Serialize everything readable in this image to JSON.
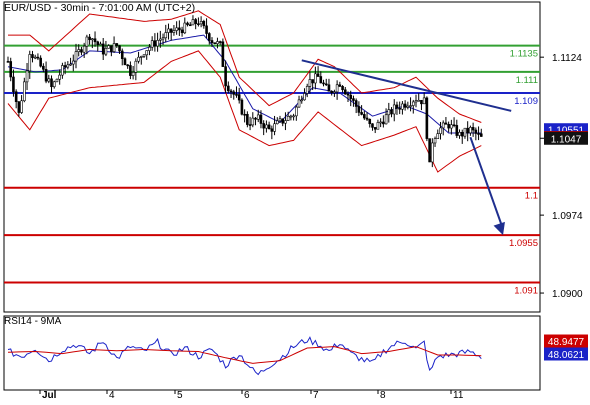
{
  "header": {
    "title": "EUR/USD - 30min - 7:01:00 AM (UTC+2)"
  },
  "rsi_label": "RSI14 - 9MA",
  "colors": {
    "candle": "#000000",
    "bollinger": "#cc0000",
    "moving_average": "#1a1aa8",
    "support": "#cc0000",
    "resistance": "#33a033",
    "pivot": "#1a22c8",
    "trendline": "#1f2f8f",
    "arrow": "#1f2f8f",
    "axis": "#000000",
    "grid": "#cccccc",
    "rsi_line": "#1a22c8",
    "rsi_ma": "#cc0000",
    "price_badge_current": "#111111",
    "price_badge_blue": "#1a22c8",
    "price_badge_red": "#cc0000"
  },
  "chart_data": [
    {
      "type": "candlestick",
      "title": "EUR/USD - 30min - 7:01:00 AM (UTC+2)",
      "y_ticks": [
        "1.1124",
        "1.1047",
        "1.0974",
        "1.0900"
      ],
      "ylim": [
        1.0882,
        1.1165
      ],
      "x_ticks": [
        "Jul",
        "4",
        "5",
        "6",
        "7",
        "8",
        "11"
      ],
      "candle_count": 175,
      "price_points": [
        [
          0,
          1.112
        ],
        [
          4,
          1.107
        ],
        [
          8,
          1.113
        ],
        [
          12,
          1.1115
        ],
        [
          16,
          1.1095
        ],
        [
          20,
          1.1112
        ],
        [
          25,
          1.1125
        ],
        [
          30,
          1.1145
        ],
        [
          35,
          1.113
        ],
        [
          40,
          1.1135
        ],
        [
          45,
          1.111
        ],
        [
          50,
          1.113
        ],
        [
          55,
          1.114
        ],
        [
          60,
          1.1148
        ],
        [
          65,
          1.1152
        ],
        [
          70,
          1.1158
        ],
        [
          75,
          1.114
        ],
        [
          78,
          1.1135
        ],
        [
          80,
          1.11
        ],
        [
          84,
          1.1085
        ],
        [
          88,
          1.1062
        ],
        [
          92,
          1.1065
        ],
        [
          96,
          1.1055
        ],
        [
          100,
          1.1062
        ],
        [
          105,
          1.107
        ],
        [
          110,
          1.11
        ],
        [
          114,
          1.1105
        ],
        [
          118,
          1.109
        ],
        [
          122,
          1.11
        ],
        [
          126,
          1.1085
        ],
        [
          130,
          1.107
        ],
        [
          134,
          1.1055
        ],
        [
          138,
          1.1065
        ],
        [
          142,
          1.1075
        ],
        [
          146,
          1.108
        ],
        [
          150,
          1.1085
        ],
        [
          153,
          1.1082
        ],
        [
          155,
          1.102
        ],
        [
          156,
          1.1045
        ],
        [
          158,
          1.1055
        ],
        [
          162,
          1.106
        ],
        [
          166,
          1.105
        ],
        [
          170,
          1.1055
        ],
        [
          174,
          1.1047
        ]
      ],
      "bands": [
        {
          "name": "upper",
          "values": [
            [
              0,
              1.1145
            ],
            [
              8,
              1.1145
            ],
            [
              15,
              1.113
            ],
            [
              30,
              1.1165
            ],
            [
              50,
              1.1158
            ],
            [
              60,
              1.116
            ],
            [
              70,
              1.1168
            ],
            [
              78,
              1.1155
            ],
            [
              85,
              1.1105
            ],
            [
              96,
              1.1078
            ],
            [
              105,
              1.109
            ],
            [
              114,
              1.1122
            ],
            [
              120,
              1.1115
            ],
            [
              130,
              1.109
            ],
            [
              142,
              1.1095
            ],
            [
              150,
              1.1105
            ],
            [
              158,
              1.1085
            ],
            [
              166,
              1.107
            ],
            [
              174,
              1.1062
            ]
          ]
        },
        {
          "name": "lower",
          "values": [
            [
              0,
              1.108
            ],
            [
              8,
              1.1055
            ],
            [
              15,
              1.1085
            ],
            [
              30,
              1.1095
            ],
            [
              50,
              1.11
            ],
            [
              60,
              1.112
            ],
            [
              70,
              1.113
            ],
            [
              78,
              1.1105
            ],
            [
              85,
              1.1055
            ],
            [
              96,
              1.104
            ],
            [
              105,
              1.1045
            ],
            [
              114,
              1.1072
            ],
            [
              120,
              1.106
            ],
            [
              130,
              1.104
            ],
            [
              142,
              1.105
            ],
            [
              150,
              1.1058
            ],
            [
              158,
              1.1015
            ],
            [
              166,
              1.103
            ],
            [
              174,
              1.104
            ]
          ]
        },
        {
          "name": "moving_average",
          "values": [
            [
              0,
              1.1115
            ],
            [
              10,
              1.111
            ],
            [
              20,
              1.1112
            ],
            [
              30,
              1.113
            ],
            [
              45,
              1.1128
            ],
            [
              60,
              1.114
            ],
            [
              72,
              1.1145
            ],
            [
              80,
              1.112
            ],
            [
              90,
              1.1075
            ],
            [
              100,
              1.1062
            ],
            [
              112,
              1.1095
            ],
            [
              122,
              1.109
            ],
            [
              134,
              1.1068
            ],
            [
              146,
              1.1078
            ],
            [
              154,
              1.107
            ],
            [
              162,
              1.1052
            ],
            [
              174,
              1.1052
            ]
          ]
        }
      ],
      "horizontal_levels": [
        {
          "value": 1.1135,
          "label": "1.1135",
          "kind": "resistance"
        },
        {
          "value": 1.111,
          "label": "1.111",
          "kind": "resistance"
        },
        {
          "value": 1.109,
          "label": "1.109",
          "kind": "pivot"
        },
        {
          "value": 1.1,
          "label": "1.1",
          "kind": "support"
        },
        {
          "value": 1.0955,
          "label": "1.0955",
          "kind": "support"
        },
        {
          "value": 1.091,
          "label": "1.091",
          "kind": "support"
        }
      ],
      "trendline": {
        "from": [
          108,
          1.1121
        ],
        "to": [
          185,
          1.1073
        ]
      },
      "forecast_arrow": {
        "from": [
          170,
          1.1048
        ],
        "to": [
          182,
          1.0955
        ]
      },
      "price_badges": [
        {
          "label": "1.10551",
          "value": 1.10551,
          "kind": "blue"
        },
        {
          "label": "1.10477",
          "value": 1.10477,
          "kind": "red"
        },
        {
          "label": "1.1047",
          "value": 1.1047,
          "kind": "current"
        }
      ]
    },
    {
      "type": "line",
      "title": "RSI14 - 9MA",
      "series": [
        {
          "name": "RSI14",
          "values": [
            [
              0,
              55
            ],
            [
              5,
              48
            ],
            [
              10,
              60
            ],
            [
              15,
              42
            ],
            [
              20,
              58
            ],
            [
              25,
              65
            ],
            [
              30,
              52
            ],
            [
              35,
              70
            ],
            [
              40,
              45
            ],
            [
              45,
              62
            ],
            [
              50,
              55
            ],
            [
              55,
              68
            ],
            [
              60,
              50
            ],
            [
              65,
              60
            ],
            [
              70,
              48
            ],
            [
              75,
              58
            ],
            [
              80,
              35
            ],
            [
              85,
              52
            ],
            [
              90,
              28
            ],
            [
              92,
              22
            ],
            [
              96,
              35
            ],
            [
              100,
              45
            ],
            [
              105,
              62
            ],
            [
              110,
              72
            ],
            [
              114,
              66
            ],
            [
              118,
              55
            ],
            [
              122,
              68
            ],
            [
              126,
              52
            ],
            [
              130,
              44
            ],
            [
              134,
              38
            ],
            [
              138,
              55
            ],
            [
              142,
              65
            ],
            [
              146,
              70
            ],
            [
              150,
              58
            ],
            [
              153,
              68
            ],
            [
              155,
              25
            ],
            [
              158,
              48
            ],
            [
              162,
              50
            ],
            [
              166,
              52
            ],
            [
              170,
              55
            ],
            [
              174,
              48
            ]
          ]
        },
        {
          "name": "9MA",
          "values": [
            [
              0,
              54
            ],
            [
              10,
              55
            ],
            [
              20,
              52
            ],
            [
              30,
              58
            ],
            [
              40,
              56
            ],
            [
              50,
              58
            ],
            [
              60,
              56
            ],
            [
              70,
              55
            ],
            [
              80,
              46
            ],
            [
              90,
              38
            ],
            [
              100,
              42
            ],
            [
              110,
              60
            ],
            [
              120,
              62
            ],
            [
              130,
              52
            ],
            [
              140,
              55
            ],
            [
              150,
              62
            ],
            [
              158,
              50
            ],
            [
              166,
              50
            ],
            [
              174,
              49
            ]
          ]
        }
      ],
      "ylim": [
        0,
        100
      ],
      "value_badges": [
        {
          "label": "48.9477",
          "value": 48.9477,
          "kind": "red"
        },
        {
          "label": "48.0621",
          "value": 48.0621,
          "kind": "blue"
        }
      ]
    }
  ]
}
